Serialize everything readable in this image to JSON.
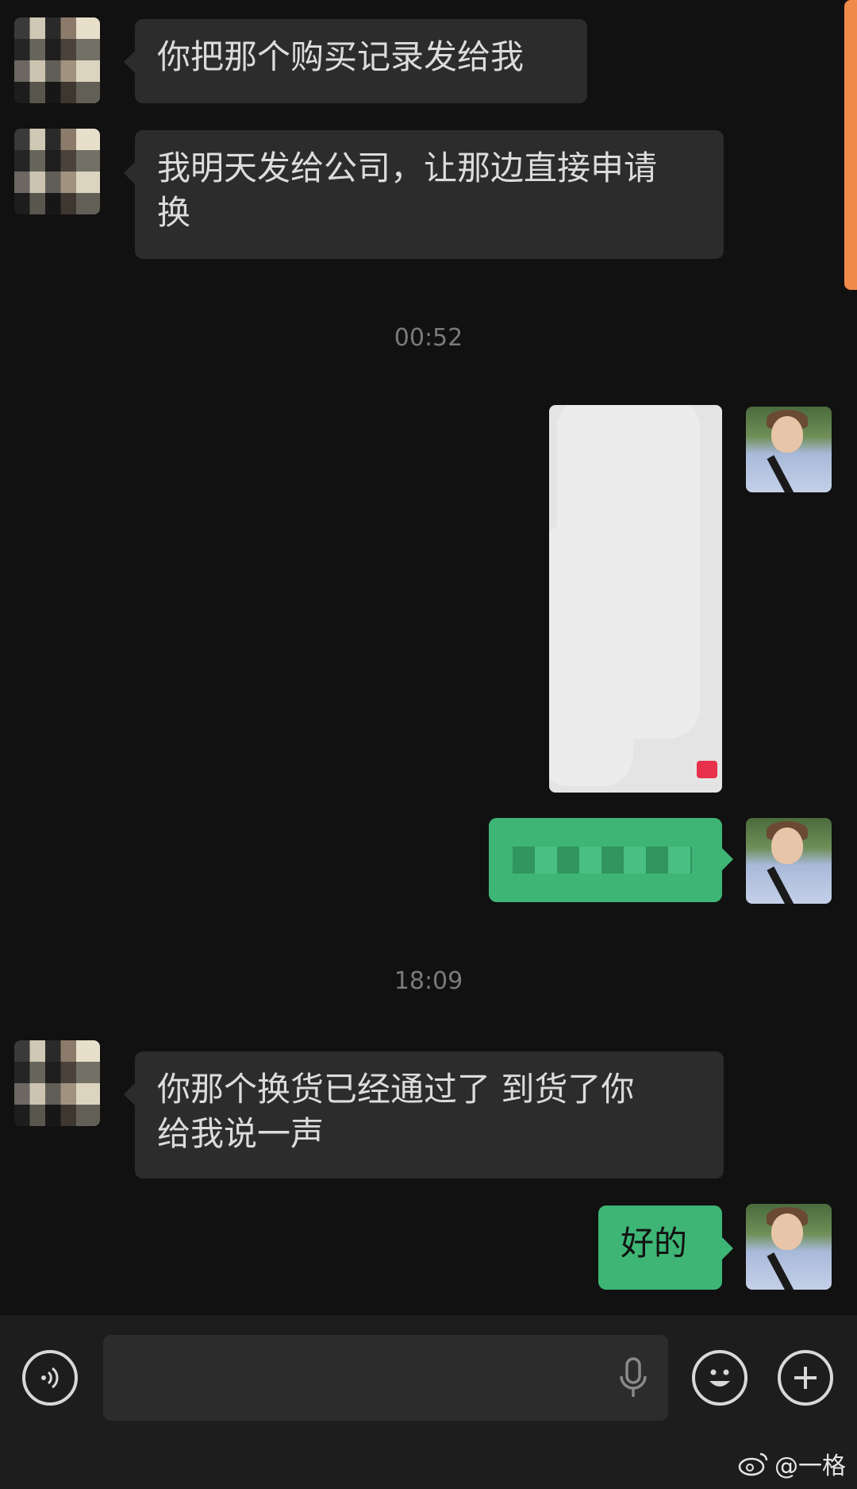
{
  "messages": {
    "m1": "你把那个购买记录发给我",
    "m2": "我明天发给公司，让那边直接申请\n换",
    "t1": "00:52",
    "t2": "18:09",
    "m3": "你那个换货已经通过了 到货了你\n给我说一声",
    "m4": "好的"
  },
  "colors": {
    "incoming_bubble": "#2c2c2c",
    "outgoing_bubble": "#3eb575",
    "scroll_indicator": "#f08a4b"
  },
  "icons": {
    "voice": "voice-input-icon",
    "mic": "microphone-icon",
    "emoji": "emoji-icon",
    "plus": "plus-icon",
    "weibo": "weibo-icon"
  },
  "watermark": {
    "text": "@一格"
  }
}
